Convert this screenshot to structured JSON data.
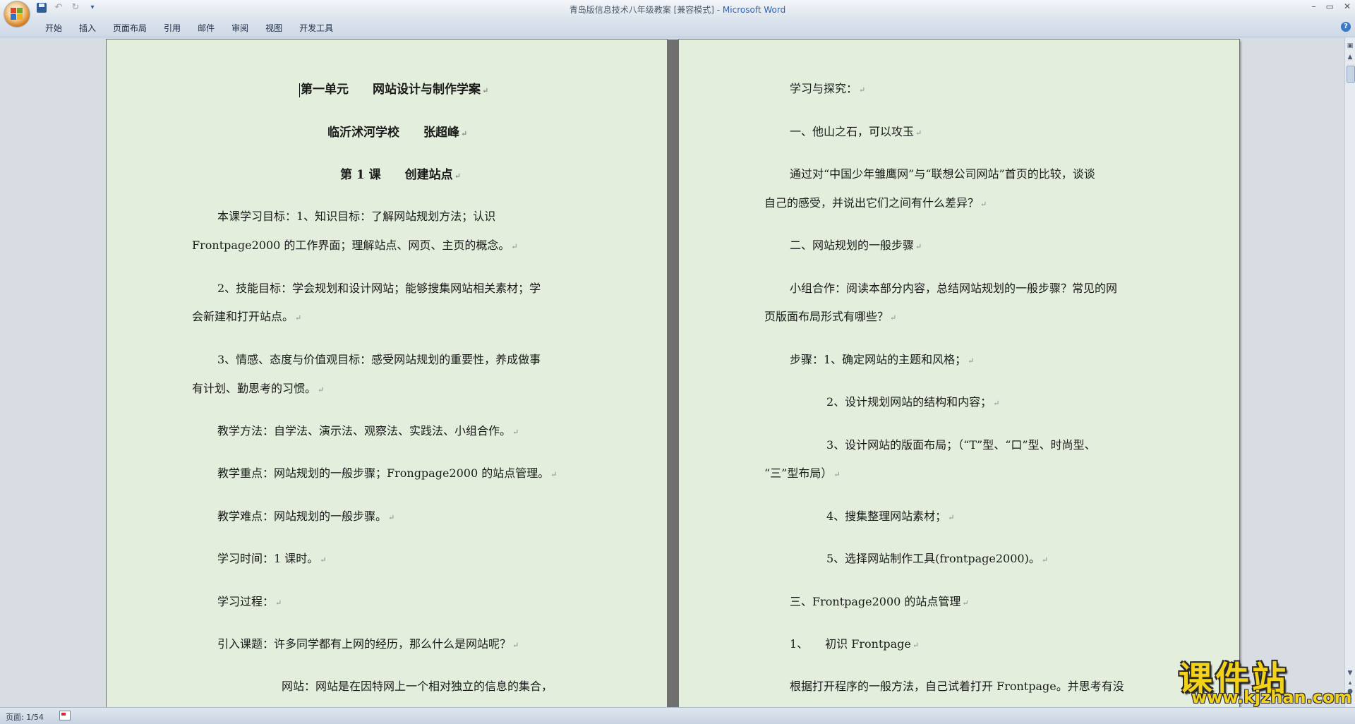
{
  "window": {
    "title_doc": "青岛版信息技术八年级教案 [兼容模式] - ",
    "title_app": "Microsoft Word",
    "minimize": "–",
    "restore": "▭",
    "close": "✕"
  },
  "quick_access": {
    "save_icon": "save-icon",
    "undo_icon": "↶",
    "redo_icon": "↻",
    "customize_icon": "▾"
  },
  "ribbon": {
    "tabs": [
      "开始",
      "插入",
      "页面布局",
      "引用",
      "邮件",
      "审阅",
      "视图",
      "开发工具"
    ],
    "help": "?"
  },
  "page1": {
    "heading1": "第一单元　　网站设计与制作学案",
    "heading2": "临沂沭河学校　　张超峰",
    "heading3": "第 1 课　　创建站点",
    "lines": [
      "本课学习目标：1、知识目标：了解网站规划方法；认识",
      "Frontpage2000 的工作界面；理解站点、网页、主页的概念。",
      "2、技能目标：学会规划和设计网站；能够搜集网站相关素材；学",
      "会新建和打开站点。",
      "3、情感、态度与价值观目标：感受网站规划的重要性，养成做事",
      "有计划、勤思考的习惯。",
      "教学方法：自学法、演示法、观察法、实践法、小组合作。",
      "教学重点：网站规划的一般步骤；Frongpage2000 的站点管理。",
      "教学难点：网站规划的一般步骤。",
      "学习时间：1 课时。",
      "学习过程：",
      "引入课题：许多同学都有上网的经历，那么什么是网站呢？",
      "网站：网站是在因特网上一个相对独立的信息的集合，"
    ]
  },
  "page2": {
    "lines": [
      "学习与探究：",
      "一、他山之石，可以攻玉",
      "通过对“中国少年雏鹰网”与“联想公司网站”首页的比较，谈谈",
      "自己的感受，并说出它们之间有什么差异？",
      "二、网站规划的一般步骤",
      "小组合作：阅读本部分内容，总结网站规划的一般步骤？常见的网",
      "页版面布局形式有哪些？",
      "步骤：1、确定网站的主题和风格；",
      "2、设计规划网站的结构和内容；",
      "3、设计网站的版面布局；（“T”型、“口”型、时尚型、",
      "“三”型布局）",
      "4、搜集整理网站素材；",
      "5、选择网站制作工具(frontpage2000)。",
      "三、Frontpage2000 的站点管理",
      "1、　　初识 Frontpage",
      "根据打开程序的一般方法，自己试着打开 Frontpage。并思考有没"
    ]
  },
  "paragraph_mark": "↵",
  "status": {
    "page": "页面: 1/54"
  },
  "watermark": {
    "big": "课件站",
    "small": "www.kjzhan.com"
  },
  "colors": {
    "page_background": "#e3efdc",
    "watermark": "#f3d21a",
    "title_app": "#2a62b8"
  }
}
